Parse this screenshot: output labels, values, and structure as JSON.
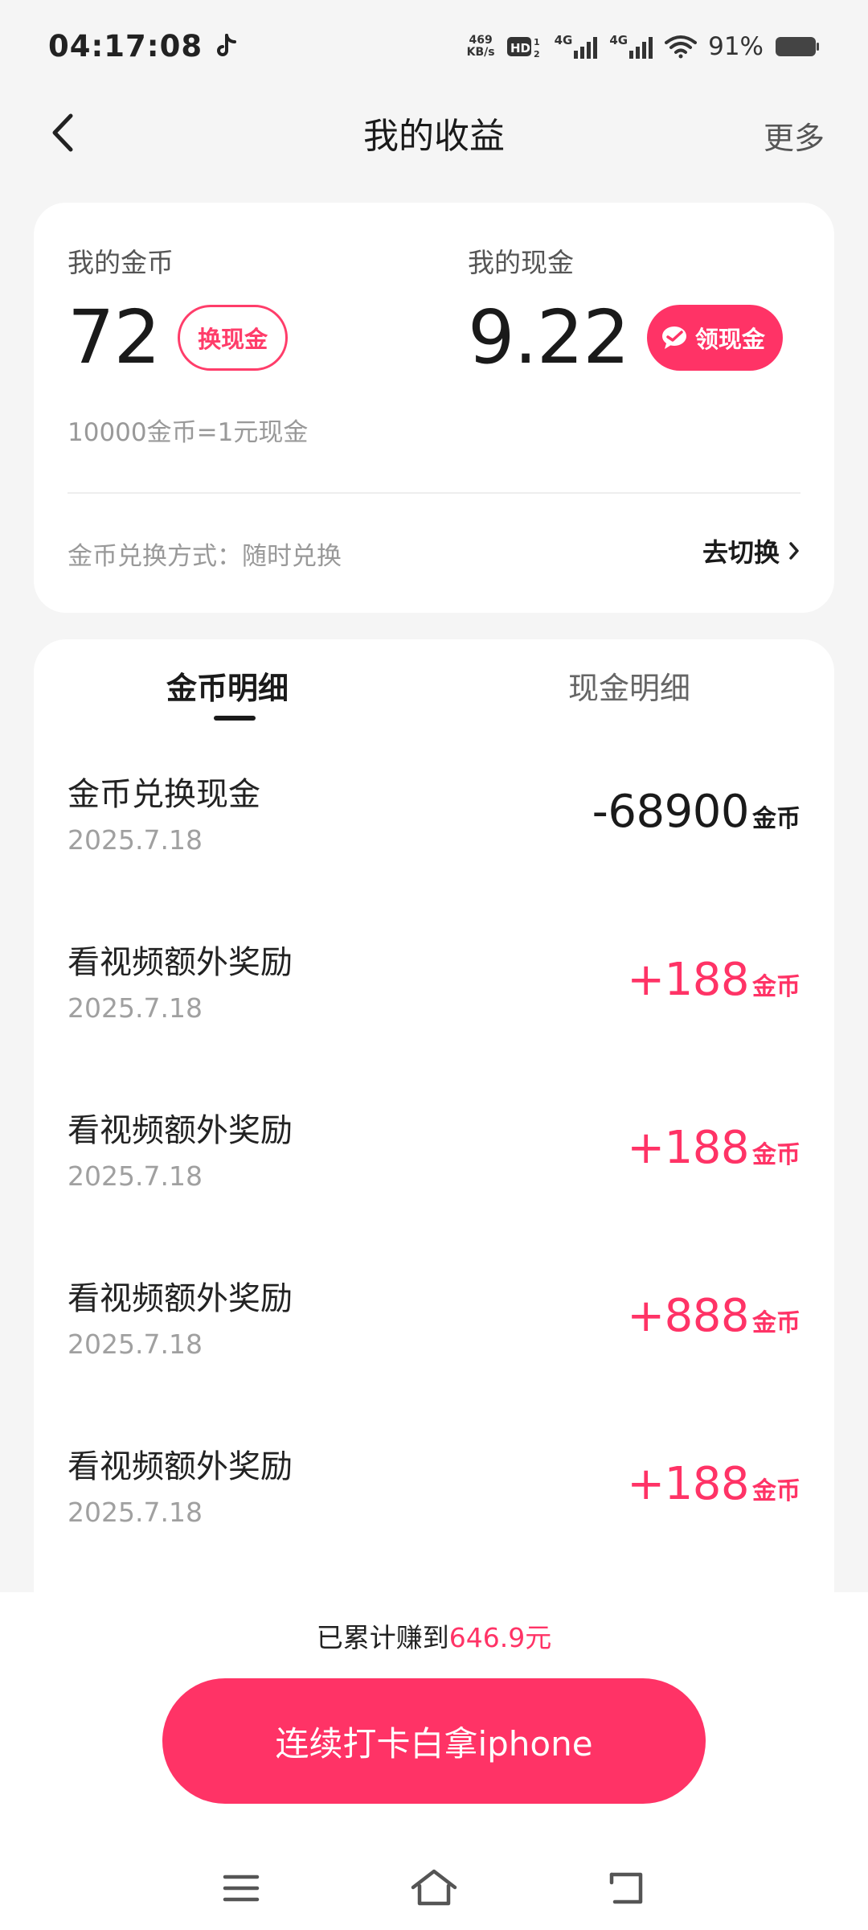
{
  "status_bar": {
    "time": "04:17:08",
    "net_speed_value": "469",
    "net_speed_unit": "KB/s",
    "signal_1": "4G",
    "signal_2": "4G",
    "battery": "91%"
  },
  "header": {
    "title": "我的收益",
    "more_label": "更多"
  },
  "summary": {
    "coins_label": "我的金币",
    "coins_value": "72",
    "exchange_button": "换现金",
    "cash_label": "我的现金",
    "cash_value": "9.22",
    "claim_button": "领现金",
    "rate_text": "10000金币=1元现金",
    "method_text": "金币兑换方式：随时兑换",
    "switch_label": "去切换"
  },
  "tabs": {
    "coins_tab": "金币明细",
    "cash_tab": "现金明细",
    "active": "coins"
  },
  "records": [
    {
      "title": "金币兑换现金",
      "date": "2025.7.18",
      "amount": "-68900",
      "unit": "金币",
      "type": "negative"
    },
    {
      "title": "看视频额外奖励",
      "date": "2025.7.18",
      "amount": "+188",
      "unit": "金币",
      "type": "positive"
    },
    {
      "title": "看视频额外奖励",
      "date": "2025.7.18",
      "amount": "+188",
      "unit": "金币",
      "type": "positive"
    },
    {
      "title": "看视频额外奖励",
      "date": "2025.7.18",
      "amount": "+888",
      "unit": "金币",
      "type": "positive"
    },
    {
      "title": "看视频额外奖励",
      "date": "2025.7.18",
      "amount": "+188",
      "unit": "金币",
      "type": "positive"
    }
  ],
  "bottom": {
    "earned_prefix": "已累计赚到",
    "earned_amount": "646.9元",
    "cta_label": "连续打卡白拿iphone"
  },
  "colors": {
    "accent": "#ff3366",
    "background": "#f5f5f5",
    "card": "#ffffff"
  },
  "icons": [
    "tiktok-icon",
    "hd-icon",
    "signal-icon",
    "wifi-icon",
    "battery-icon",
    "back-arrow-icon",
    "wechat-icon",
    "chevron-right-icon",
    "menu-icon",
    "home-icon",
    "return-icon"
  ]
}
